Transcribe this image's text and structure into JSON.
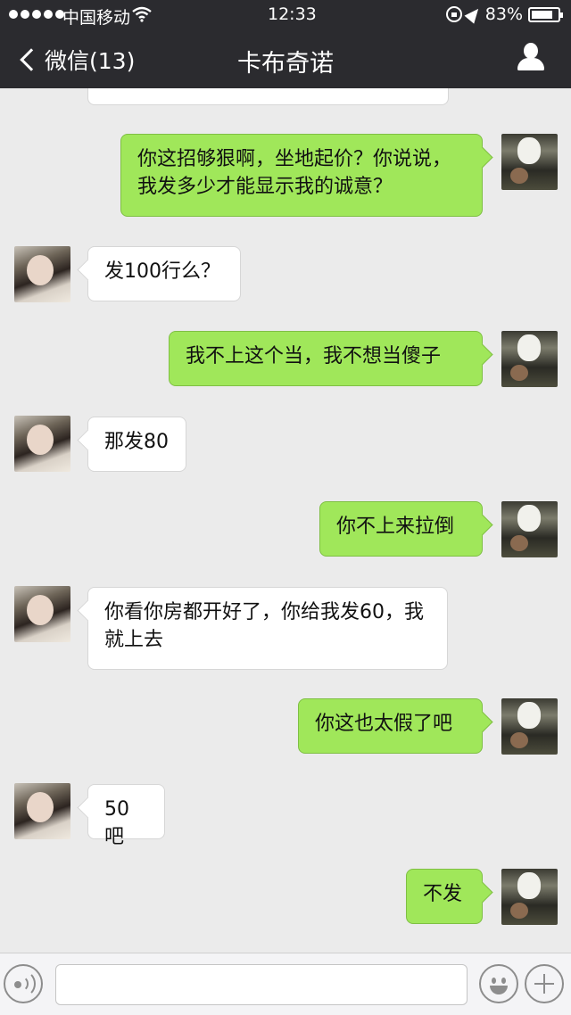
{
  "status_bar": {
    "carrier": "中国移动",
    "time": "12:33",
    "battery": "83%",
    "battery_level": 0.83,
    "icons": [
      "signal-dots-icon",
      "wifi-icon",
      "rotation-lock-icon",
      "location-arrow-icon",
      "battery-icon"
    ]
  },
  "nav": {
    "back_label": "微信(13)",
    "title": "卡布奇诺",
    "icons": [
      "chevron-left-icon",
      "profile-icon"
    ]
  },
  "messages": [
    {
      "side": "out",
      "text": "你这招够狠啊，坐地起价？你说说，我发多少才能显示我的诚意？"
    },
    {
      "side": "in",
      "text": "发100行么？"
    },
    {
      "side": "out",
      "text": "我不上这个当，我不想当傻子"
    },
    {
      "side": "in",
      "text": "那发80"
    },
    {
      "side": "out",
      "text": "你不上来拉倒"
    },
    {
      "side": "in",
      "text": "你看你房都开好了，你给我发60，我就上去"
    },
    {
      "side": "out",
      "text": "你这也太假了吧"
    },
    {
      "side": "in",
      "text": "50吧"
    },
    {
      "side": "out",
      "text": "不发"
    }
  ],
  "input_bar": {
    "input_value": "",
    "icons": [
      "voice-icon",
      "emoji-icon",
      "plus-icon"
    ]
  }
}
